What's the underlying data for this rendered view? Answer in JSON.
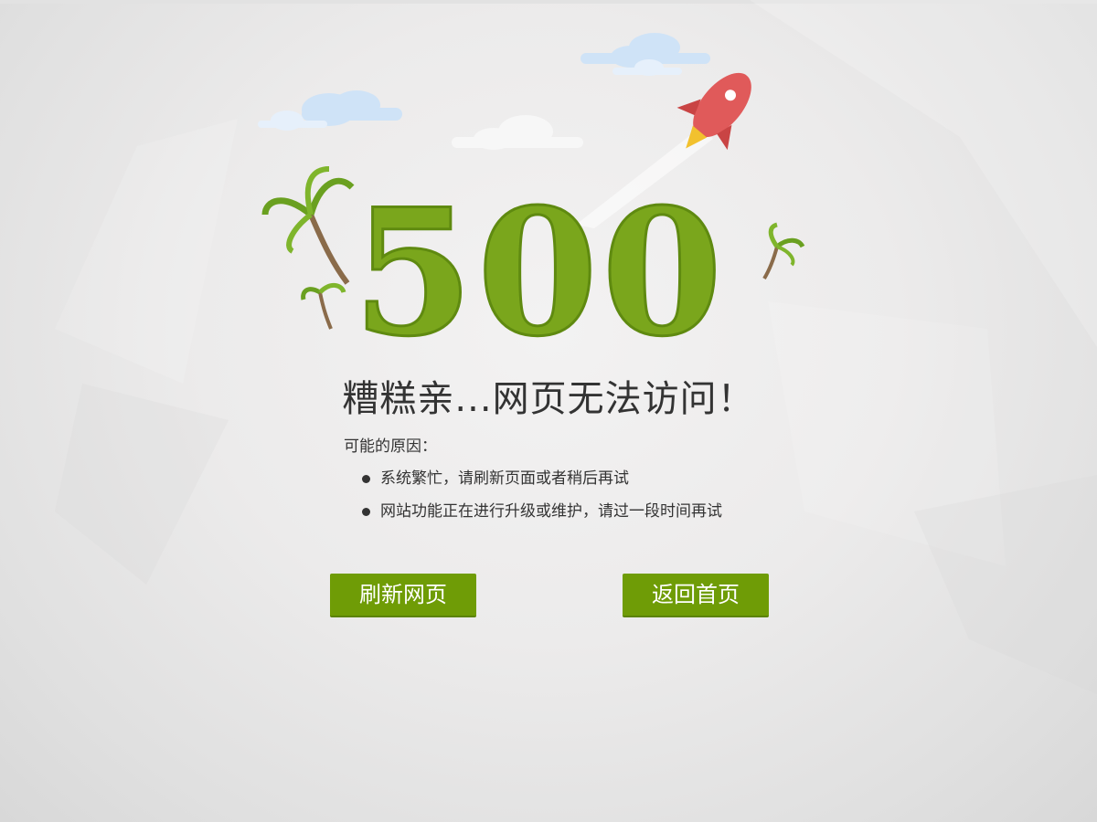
{
  "error": {
    "code": "500",
    "headline": "糟糕亲...网页无法访问！"
  },
  "reasons": {
    "title": "可能的原因：",
    "items": [
      "系统繁忙，请刷新页面或者稍后再试",
      "网站功能正在进行升级或维护，请过一段时间再试"
    ]
  },
  "buttons": {
    "refresh_label": "刷新网页",
    "home_label": "返回首页"
  },
  "colors": {
    "accent_green": "#6f9c06",
    "digits_green": "#7aa61c",
    "text": "#333333",
    "rocket": "#e05a5a"
  },
  "icons": [
    "cloud-icon",
    "rocket-icon",
    "palm-tree-icon"
  ]
}
